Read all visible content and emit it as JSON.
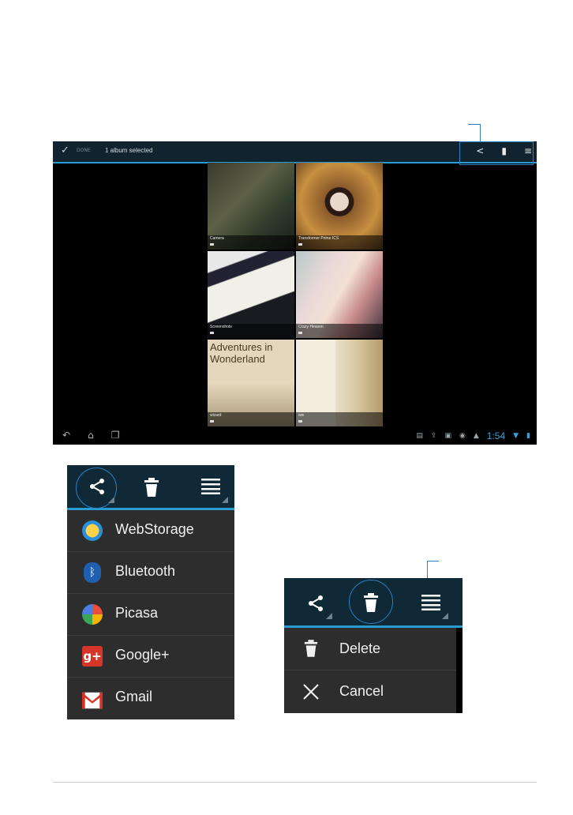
{
  "tablet": {
    "action_bar": {
      "done_label": "DONE",
      "selection_text": "1 album selected"
    },
    "albums": [
      {
        "name": "Camera",
        "count": "4"
      },
      {
        "name": "Transformer Prime ICS",
        "count": "1"
      },
      {
        "name": "Screenshots",
        "count": "20"
      },
      {
        "name": "Crazy Heaven",
        "count": "1"
      },
      {
        "name": "wizard",
        "count": "1"
      },
      {
        "name": "ww",
        "count": "5"
      }
    ],
    "album5_cover_text": "Adventures in Wonderland",
    "status": {
      "clock": "1:54"
    }
  },
  "share_menu": {
    "items": [
      {
        "label": "WebStorage",
        "icon": "webstorage-icon",
        "color": "#f5a623"
      },
      {
        "label": "Bluetooth",
        "icon": "bluetooth-icon",
        "color": "#1e5fb0"
      },
      {
        "label": "Picasa",
        "icon": "picasa-icon",
        "color": "#e94e3a"
      },
      {
        "label": "Google+",
        "icon": "google-plus-icon",
        "color": "#d8352a"
      },
      {
        "label": "Gmail",
        "icon": "gmail-icon",
        "color": "#d93025"
      }
    ]
  },
  "delete_menu": {
    "items": [
      {
        "label": "Delete",
        "icon": "trash-icon"
      },
      {
        "label": "Cancel",
        "icon": "close-icon"
      }
    ]
  },
  "colors": {
    "accent": "#2a9bd1",
    "callout": "#2b7fc2",
    "action_bar_bg": "#0f2a36",
    "menu_bg": "#2d2d2d"
  }
}
